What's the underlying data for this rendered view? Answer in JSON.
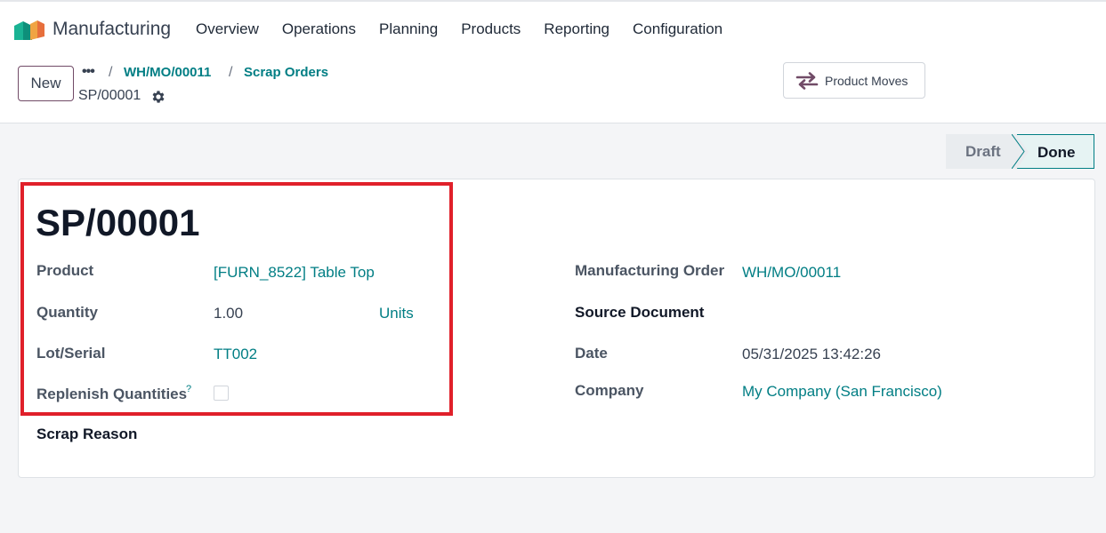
{
  "app": {
    "name": "Manufacturing",
    "logo_icon": "manufacturing-logo-icon"
  },
  "menu": [
    "Overview",
    "Operations",
    "Planning",
    "Products",
    "Reporting",
    "Configuration"
  ],
  "control_panel": {
    "new_label": "New",
    "breadcrumbs": [
      "WH/MO/00011",
      "Scrap Orders"
    ],
    "record_name": "SP/00001",
    "smart_button": {
      "label": "Product Moves",
      "icon": "arrows-swap-icon"
    }
  },
  "status": {
    "stages": [
      "Draft",
      "Done"
    ],
    "current": "Done"
  },
  "form": {
    "title": "SP/00001",
    "product_label": "Product",
    "product_value": "[FURN_8522] Table Top",
    "quantity_label": "Quantity",
    "quantity_value": "1.00",
    "quantity_uom": "Units",
    "lot_label": "Lot/Serial",
    "lot_value": "TT002",
    "replenish_label": "Replenish Quantities",
    "replenish_help": "?",
    "scrap_reason_label": "Scrap Reason",
    "mo_label": "Manufacturing Order",
    "mo_value": "WH/MO/00011",
    "source_label": "Source Document",
    "date_label": "Date",
    "date_value": "05/31/2025 13:42:26",
    "company_label": "Company",
    "company_value": "My Company (San Francisco)"
  },
  "colors": {
    "link": "#017e84",
    "highlight": "#e0202a",
    "primary": "#714b67"
  }
}
